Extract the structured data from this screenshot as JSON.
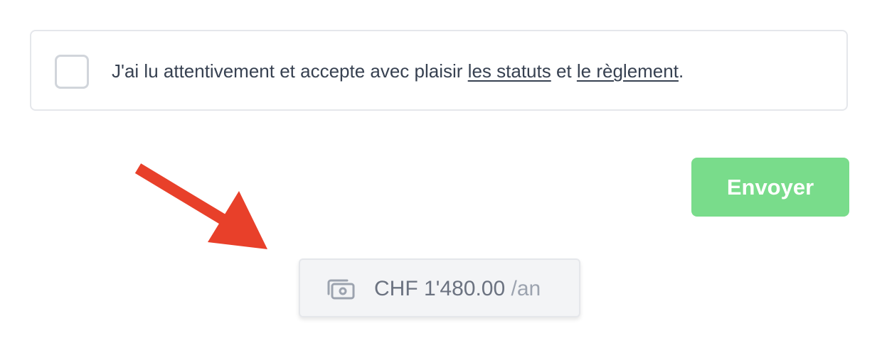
{
  "consent": {
    "text_before": "J'ai lu attentivement et accepte avec plaisir ",
    "link_statuts": "les statuts",
    "text_middle": " et ",
    "link_reglement": "le règlement",
    "text_after": "."
  },
  "submit": {
    "label": "Envoyer"
  },
  "price": {
    "amount": "CHF 1'480.00",
    "unit": " /an"
  },
  "icons": {
    "price_icon": "cash-icon",
    "annotation": "red-arrow-icon"
  },
  "colors": {
    "submit_button": "#79dc8b",
    "arrow": "#e8402a",
    "text": "#374151",
    "price_text": "#6b7280"
  }
}
